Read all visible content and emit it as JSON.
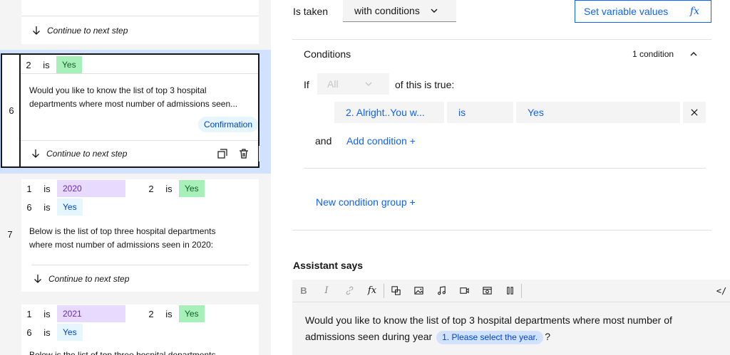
{
  "steps": [
    {
      "footer": "Continue to next step"
    },
    {
      "number": "6",
      "condition_num": "2",
      "is": "is",
      "condition_value": "Yes",
      "body": "Would you like to know the list of top 3 hospital departments where most number of admissions seen...",
      "badge": "Confirmation",
      "footer": "Continue to next step"
    },
    {
      "number": "7",
      "conditions": [
        {
          "num": "1",
          "is": "is",
          "value": "2020"
        },
        {
          "num": "2",
          "is": "is",
          "value": "Yes"
        },
        {
          "num": "6",
          "is": "is",
          "value": "Yes"
        }
      ],
      "body_line1": "Below is the list of top three hospital departments",
      "body_line2": "where most number of admissions seen in 2020:",
      "footer": "Continue to next step"
    },
    {
      "conditions": [
        {
          "num": "1",
          "is": "is",
          "value": "2021"
        },
        {
          "num": "2",
          "is": "is",
          "value": "Yes"
        },
        {
          "num": "6",
          "is": "is",
          "value": "Yes"
        }
      ],
      "body_partial": "Below is the list of top three hospital departments"
    }
  ],
  "right": {
    "is_taken_label": "Is taken",
    "is_taken_value": "with conditions",
    "set_variable_button": "Set variable values",
    "fx_symbol": "fx",
    "conditions_title": "Conditions",
    "condition_count": "1 condition",
    "if_label": "If",
    "all_select": "All",
    "of_this_true": "of this is true:",
    "condition_row": {
      "field": "2. Alright..You w...",
      "operator": "is",
      "value": "Yes"
    },
    "and_label": "and",
    "add_condition": "Add condition +",
    "new_condition_group": "New condition group +",
    "assistant_says": "Assistant says",
    "toolbar": [
      "B",
      "I",
      "link-icon",
      "fx",
      "variable-icon",
      "image-icon",
      "audio-icon",
      "video-icon",
      "iframe-icon",
      "pause-icon",
      "code-icon"
    ],
    "toolbar_code": "</",
    "message_before": "Would you like to know the list of top 3 hospital departments where most number of admissions seen during year",
    "message_variable": "1. Please select the year.",
    "message_after": "?"
  },
  "colors": {
    "accent": "#0f62fe",
    "selected_bg": "#d0e2ff",
    "yes_tag": "#a7f0ba",
    "purple_tag": "#e8daff",
    "blue_tag": "#e5f6ff"
  }
}
